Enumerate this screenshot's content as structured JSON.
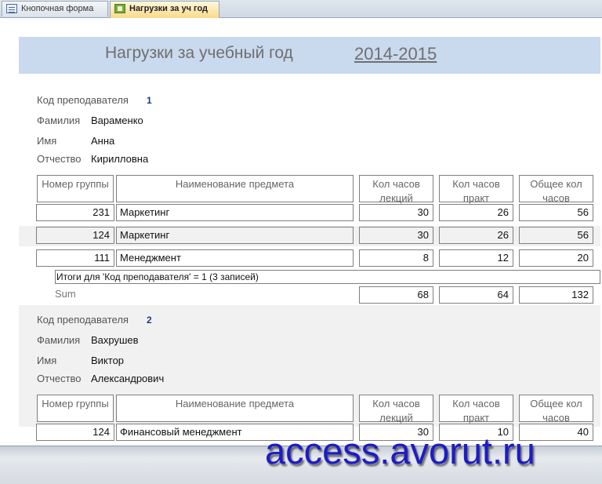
{
  "tabs": [
    {
      "label": "Кнопочная форма",
      "icon": "form-icon"
    },
    {
      "label": "Нагрузки за уч год",
      "icon": "report-icon",
      "active": true
    }
  ],
  "report": {
    "title": "Нагрузки за учебный год",
    "year": "2014-2015",
    "field_labels": {
      "code": "Код преподавателя",
      "surname": "Фамилия",
      "name": "Имя",
      "patronymic": "Отчество"
    },
    "columns": [
      "Номер группы",
      "Наименование предмета",
      "Кол часов лекций",
      "Кол часов практ",
      "Общее кол часов"
    ],
    "teachers": [
      {
        "code": "1",
        "surname": "Вараменко",
        "name": "Анна",
        "patronymic": "Кирилловна",
        "rows": [
          {
            "group": "231",
            "subject": "Маркетинг",
            "lectures": "30",
            "practice": "26",
            "total": "56"
          },
          {
            "group": "124",
            "subject": "Маркетинг",
            "lectures": "30",
            "practice": "26",
            "total": "56"
          },
          {
            "group": "111",
            "subject": "Менеджмент",
            "lectures": "8",
            "practice": "12",
            "total": "20"
          }
        ],
        "summary": "Итоги для 'Код преподавателя' = 1 (3 записей)",
        "sum_label": "Sum",
        "sums": {
          "lectures": "68",
          "practice": "64",
          "total": "132"
        }
      },
      {
        "code": "2",
        "surname": "Вахрушев",
        "name": "Виктор",
        "patronymic": "Александрович",
        "rows": [
          {
            "group": "124",
            "subject": "Финансовый менеджмент",
            "lectures": "30",
            "practice": "10",
            "total": "40"
          }
        ]
      }
    ]
  },
  "watermark": "access.avorut.ru"
}
